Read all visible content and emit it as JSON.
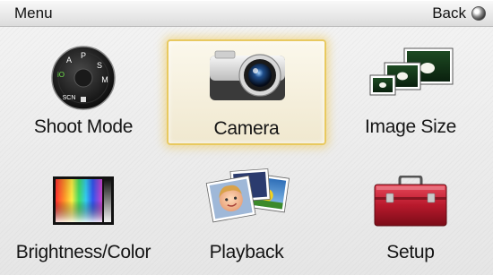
{
  "header": {
    "title": "Menu",
    "back_label": "Back"
  },
  "tiles": [
    {
      "label": "Shoot Mode",
      "icon": "mode-dial-icon"
    },
    {
      "label": "Camera",
      "icon": "camera-icon"
    },
    {
      "label": "Image Size",
      "icon": "image-size-icon"
    },
    {
      "label": "Brightness/Color",
      "icon": "color-palette-icon"
    },
    {
      "label": "Playback",
      "icon": "photos-icon"
    },
    {
      "label": "Setup",
      "icon": "toolbox-icon"
    }
  ],
  "dial": {
    "modes": [
      "P",
      "A",
      "S",
      "M",
      "SCN",
      "iO"
    ]
  },
  "colors": {
    "selection_border": "#e8c960",
    "selection_bg": "#f6f0d8"
  }
}
